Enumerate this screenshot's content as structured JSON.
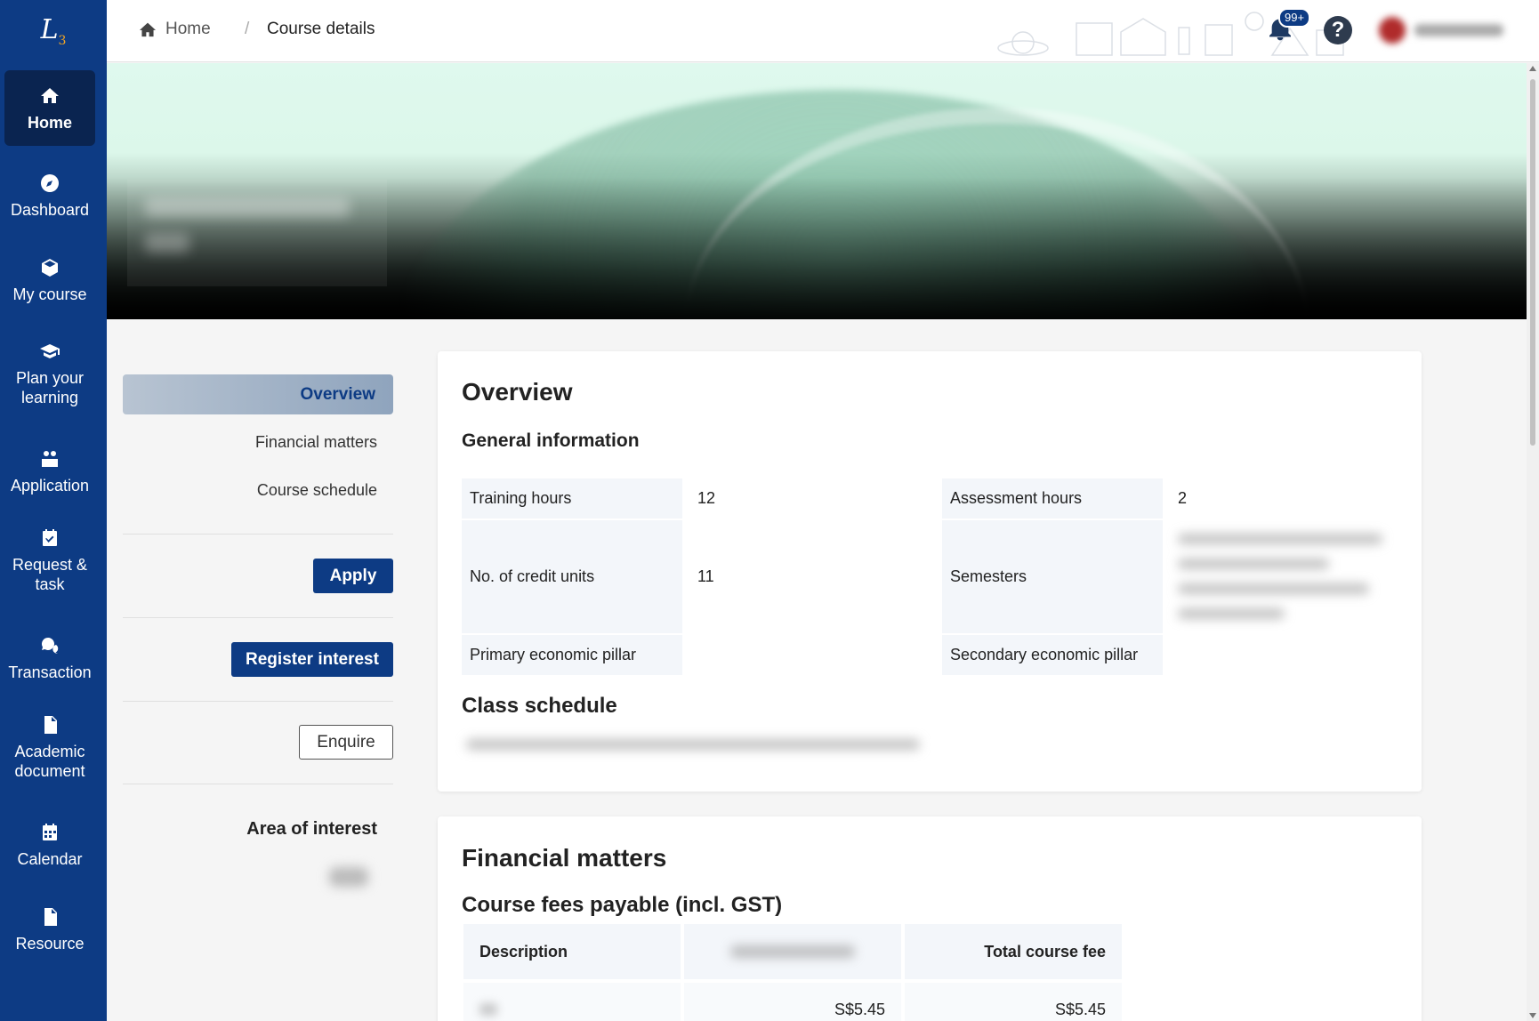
{
  "sidebar": {
    "logo_text": "L",
    "logo_sub": "3",
    "items": [
      {
        "label": "Home",
        "icon": "home-icon"
      },
      {
        "label": "Dashboard",
        "icon": "compass-icon"
      },
      {
        "label": "My course",
        "icon": "cube-icon"
      },
      {
        "label": "Plan your learning",
        "icon": "graduation-cap-icon"
      },
      {
        "label": "Application",
        "icon": "people-icon"
      },
      {
        "label": "Request & task",
        "icon": "calendar-check-icon"
      },
      {
        "label": "Transaction",
        "icon": "money-chat-icon"
      },
      {
        "label": "Academic document",
        "icon": "pdf-file-icon"
      },
      {
        "label": "Calendar",
        "icon": "calendar-icon"
      },
      {
        "label": "Resource",
        "icon": "document-icon"
      }
    ],
    "active_index": 0
  },
  "header": {
    "breadcrumb_home": "Home",
    "breadcrumb_sep": "/",
    "breadcrumb_current": "Course details",
    "notification_badge": "99+",
    "help_label": "?"
  },
  "subnav": {
    "active": "Overview",
    "links": [
      "Financial matters",
      "Course schedule"
    ],
    "apply": "Apply",
    "register": "Register interest",
    "enquire": "Enquire",
    "area_of_interest": "Area of interest"
  },
  "overview": {
    "title": "Overview",
    "general_title": "General information",
    "training_hours_label": "Training hours",
    "training_hours_value": "12",
    "assessment_hours_label": "Assessment hours",
    "assessment_hours_value": "2",
    "credit_units_label": "No. of credit units",
    "credit_units_value": "11",
    "semesters_label": "Semesters",
    "primary_pillar_label": "Primary economic pillar",
    "secondary_pillar_label": "Secondary economic pillar",
    "class_schedule_title": "Class schedule"
  },
  "financial": {
    "title": "Financial matters",
    "fees_title": "Course fees payable (incl. GST)",
    "col_description": "Description",
    "col_total": "Total course fee",
    "row1_col2": "S$5.45",
    "row1_total": "S$5.45"
  },
  "colors": {
    "sidebar": "#0d3b84",
    "active_nav": "#0a2450",
    "primary_button": "#0d3b84"
  }
}
